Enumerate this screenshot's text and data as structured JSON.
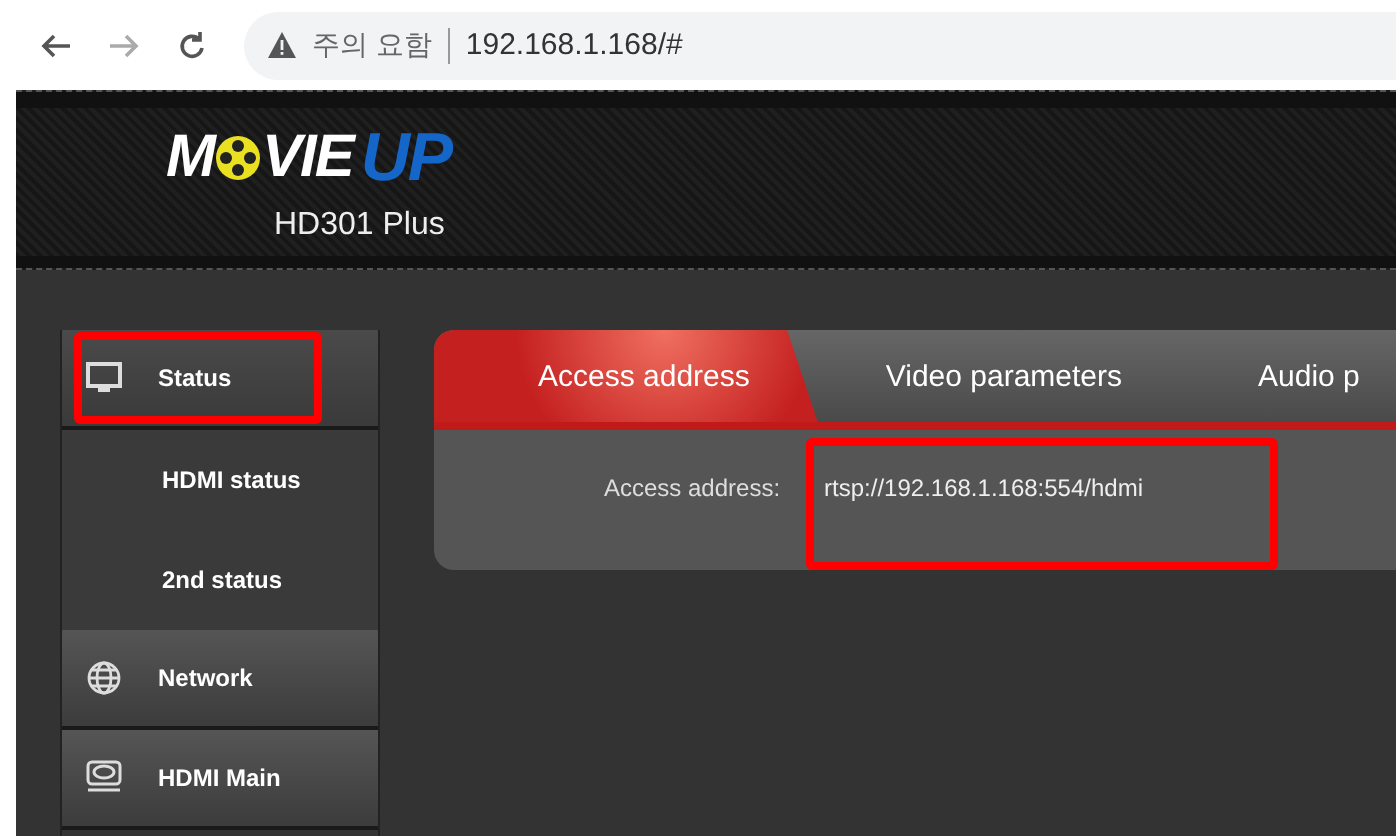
{
  "browser": {
    "warning": "주의 요함",
    "url": "192.168.1.168/#"
  },
  "header": {
    "logo": {
      "first": "M",
      "rest": "VIE",
      "accent": "UP"
    },
    "product": "HD301 Plus"
  },
  "sidebar": {
    "items": [
      {
        "label": "Status",
        "kind": "monitor",
        "selected": true,
        "highlighted": true,
        "children": [
          {
            "label": "HDMI status"
          },
          {
            "label": "2nd status"
          }
        ]
      },
      {
        "label": "Network",
        "kind": "globe",
        "selected": false,
        "highlighted": false
      },
      {
        "label": "HDMI Main",
        "kind": "disk",
        "selected": false,
        "highlighted": false
      }
    ]
  },
  "tabs": [
    {
      "label": "Access address",
      "selected": true
    },
    {
      "label": "Video parameters",
      "selected": false
    },
    {
      "label": "Audio p",
      "selected": false
    }
  ],
  "fields": [
    {
      "label": "Access address:",
      "value": "rtsp://192.168.1.168:554/hdmi",
      "highlighted": true
    }
  ]
}
